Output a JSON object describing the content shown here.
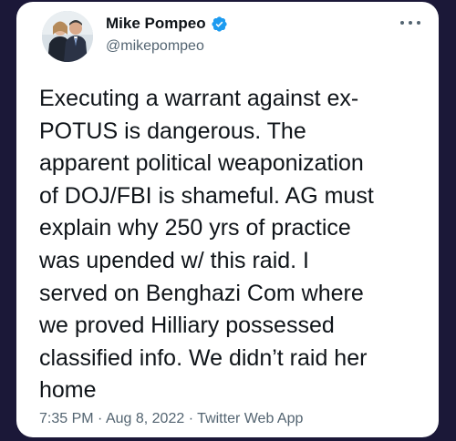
{
  "tweet": {
    "display_name": "Mike Pompeo",
    "handle": "@mikepompeo",
    "verified": true,
    "text_lines": [
      "Executing a warrant against ex-",
      "POTUS is dangerous. The",
      "apparent political weaponization",
      "of DOJ/FBI is shameful. AG must",
      "explain why 250 yrs of practice",
      "was upended w/ this raid. I",
      "served on Benghazi Com where",
      "we proved Hilliary possessed",
      "classified info. We didn’t raid her",
      "home"
    ],
    "time": "7:35 PM",
    "date": "Aug 8, 2022",
    "source": "Twitter Web App",
    "separator": "·"
  },
  "icons": {
    "verified": "verified-badge-icon",
    "more": "more-options-icon"
  },
  "colors": {
    "background": "#1b1838",
    "card": "#ffffff",
    "text_primary": "#0f1419",
    "text_secondary": "#536471",
    "verified_blue": "#1d9bf0"
  }
}
